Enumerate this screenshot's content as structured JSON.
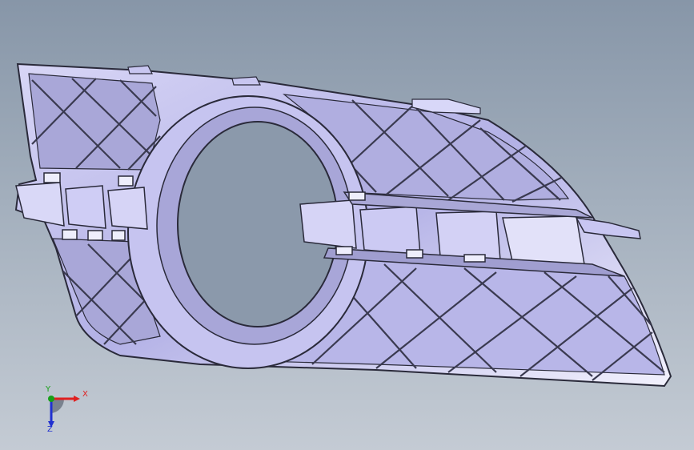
{
  "viewport": {
    "background_top": "#8796a8",
    "background_bottom": "#c4cbd4"
  },
  "model": {
    "part_fill": "#b8b6ec",
    "part_shadow": "#7c7aa8",
    "part_highlight": "#ecebfc",
    "edge_color": "#2a2a3a",
    "hole_color": "#8b99ab"
  },
  "triad": {
    "x_label": "X",
    "y_label": "Y",
    "z_label": "Z",
    "x_color": "#e02020",
    "y_color": "#18a018",
    "z_color": "#2030d0"
  }
}
